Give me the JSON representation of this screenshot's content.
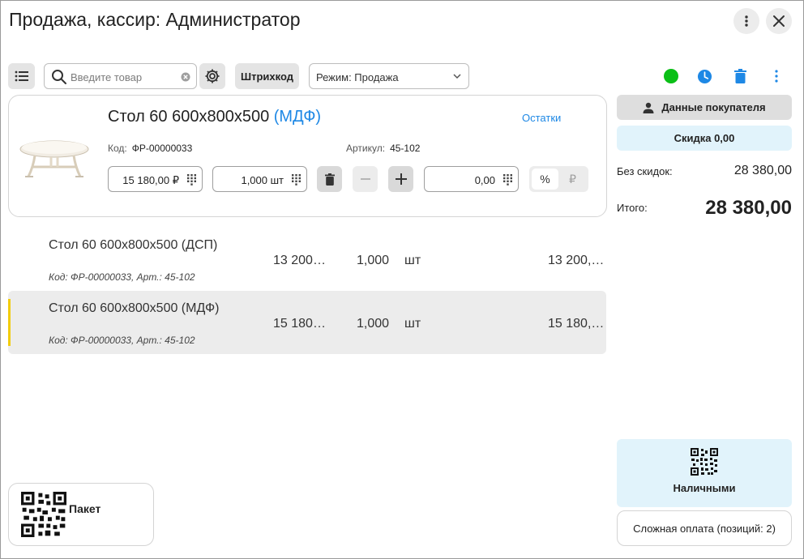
{
  "window": {
    "title": "Продажа, кассир: Администратор"
  },
  "toolbar": {
    "search_placeholder": "Введите товар",
    "barcode_label": "Штрихкод",
    "mode_label": "Режим: Продажа"
  },
  "status": {
    "connection_color": "#0bbf17",
    "accent_color": "#1e88e5"
  },
  "current_item": {
    "title_main": "Стол 60 600х800х500",
    "title_accent": "(МДФ)",
    "stock_link": "Остатки",
    "code_label": "Код:",
    "code": "ФР-00000033",
    "article_label": "Артикул:",
    "article": "45-102",
    "price": "15 180,00 ₽",
    "quantity": "1,000 шт",
    "discount": "0,00",
    "discount_percent": "%",
    "discount_currency": "₽"
  },
  "lines": [
    {
      "name": "Стол 60 600х800х500 (ДСП)",
      "sub": "Код: ФР-00000033, Арт.: 45-102",
      "price": "13 200…",
      "qty": "1,000",
      "unit": "шт",
      "sum": "13 200,…",
      "selected": false
    },
    {
      "name": "Стол 60 600х800х500 (МДФ)",
      "sub": "Код: ФР-00000033, Арт.: 45-102",
      "price": "15 180…",
      "qty": "1,000",
      "unit": "шт",
      "sum": "15 180,…",
      "selected": true
    }
  ],
  "summary": {
    "customer_button": "Данные покупателя",
    "discount_button": "Скидка 0,00",
    "no_discount_label": "Без скидок:",
    "no_discount_value": "28 380,00",
    "total_label": "Итого:",
    "total_value": "28 380,00"
  },
  "payment": {
    "cash_label": "Наличными",
    "complex_label": "Сложная оплата (позиций: 2)"
  },
  "packet": {
    "label": "Пакет"
  }
}
